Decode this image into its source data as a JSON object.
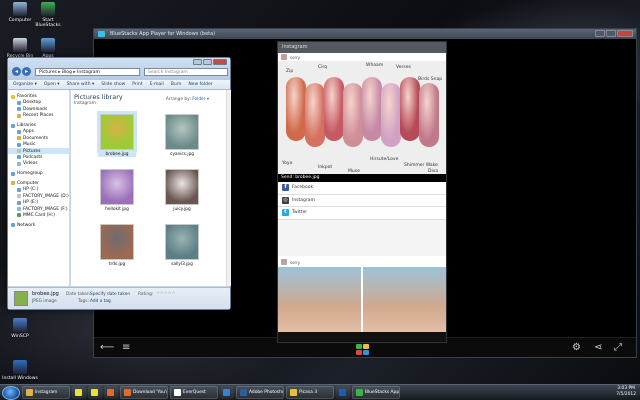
{
  "desktop_icons": [
    {
      "label": "Computer",
      "color": "#8fb6d8"
    },
    {
      "label": "Start BlueStacks",
      "color": "#39b54a"
    },
    {
      "label": "Recycle Bin",
      "color": "#c9d4de"
    },
    {
      "label": "Apps",
      "color": "#5aa0e0"
    },
    {
      "label": "WinSCP",
      "color": "#4a7fd0"
    },
    {
      "label": "Install Windows",
      "color": "#2f6fc0"
    }
  ],
  "bluestacks": {
    "title": "BlueStacks App Player for Windows (beta)",
    "nav": {
      "back": "back-arrow",
      "menu": "menu",
      "settings": "gear",
      "share": "share",
      "fullscreen": "fullscreen"
    }
  },
  "instagram": {
    "header": "Instagram",
    "post_user": "sorry",
    "swatch_labels": [
      "Zip",
      "Cirq",
      "Whaam",
      "Verses",
      "Birds Snap",
      "Yoyo",
      "Inkpot",
      "Muse",
      "Hirsute/Love",
      "Shimmer Wake",
      "Diva"
    ],
    "send_title": "Send: brobee.jpg",
    "share_options": [
      {
        "label": "Facebook",
        "icon": "f",
        "color": "#3b5998"
      },
      {
        "label": "Instagram",
        "icon": "◎",
        "color": "#3f3f3f"
      },
      {
        "label": "Twitter",
        "icon": "t",
        "color": "#2aa9e0"
      }
    ],
    "second_user": "sorry"
  },
  "explorer": {
    "address": [
      "Pictures",
      "Blog",
      "Instagram"
    ],
    "search_placeholder": "Search Instagram",
    "toolbar": [
      "Organize ▾",
      "Open ▾",
      "Share with ▾",
      "Slide show",
      "Print",
      "E-mail",
      "Burn",
      "New folder"
    ],
    "nav_groups": [
      {
        "items": [
          "Favorites",
          "Desktop",
          "Downloads",
          "Recent Places"
        ]
      },
      {
        "items": [
          "Libraries",
          "Apps",
          "Documents",
          "Music",
          "Pictures",
          "Podcasts",
          "Videos"
        ]
      },
      {
        "items": [
          "Homegroup"
        ]
      },
      {
        "items": [
          "Computer",
          "HP (C:)",
          "FACTORY_IMAGE (D:)",
          "HP (E:)",
          "FACTORY_IMAGE (F:)",
          "MMC Card (H:)"
        ]
      },
      {
        "items": [
          "Network"
        ]
      }
    ],
    "library_title": "Pictures library",
    "library_sub": "Instagram",
    "arrange_label": "Arrange by:",
    "arrange_value": "Folder ▾",
    "thumbnails": [
      {
        "name": "brobee.jpg",
        "colors": [
          "#9acd32",
          "#d5b04a"
        ],
        "selected": true
      },
      {
        "name": "cyanics.jpg",
        "colors": [
          "#6b8b8a",
          "#b4c6c2"
        ],
        "selected": false
      },
      {
        "name": "hellokit.jpg",
        "colors": [
          "#9b6fb9",
          "#d8c3e3"
        ],
        "selected": false
      },
      {
        "name": "juicy.jpg",
        "colors": [
          "#6a5650",
          "#e9e6e6"
        ],
        "selected": false
      },
      {
        "name": "trds.jpg",
        "colors": [
          "#9c6a50",
          "#6f6c72"
        ],
        "selected": false
      },
      {
        "name": "sallyl3.jpg",
        "colors": [
          "#5b7f86",
          "#9bb2b2"
        ],
        "selected": false
      }
    ],
    "details": {
      "name": "brobee.jpg",
      "type": "JPEG image",
      "date_key": "Date taken:",
      "date_val": "Specify date taken",
      "tags_key": "Tags:",
      "tags_val": "Add a tag",
      "rating_key": "Rating:",
      "rating_stars": "☆☆☆☆☆"
    }
  },
  "taskbar": {
    "items": [
      {
        "label": "Instagram",
        "color": "#e0b24a",
        "wide": true
      },
      {
        "label": "",
        "color": "#e8e040",
        "wide": false
      },
      {
        "label": "",
        "color": "#e8e040",
        "wide": false
      },
      {
        "label": "",
        "color": "#e06b2a",
        "wide": false
      },
      {
        "label": "Download 'You're ...",
        "color": "#e06b2a",
        "wide": true
      },
      {
        "label": "EverQuest",
        "color": "#ffffff",
        "wide": true
      },
      {
        "label": "",
        "color": "#3a7fd0",
        "wide": false
      },
      {
        "label": "Adobe Photosho...",
        "color": "#2f5d9a",
        "wide": true
      },
      {
        "label": "Picasa 3",
        "color": "#e8c040",
        "wide": true
      },
      {
        "label": "",
        "color": "#1a5fb4",
        "wide": false
      },
      {
        "label": "BlueStacks App Pl...",
        "color": "#39b54a",
        "wide": true
      }
    ],
    "time": "3:03 PM",
    "date": "7/5/2012"
  }
}
